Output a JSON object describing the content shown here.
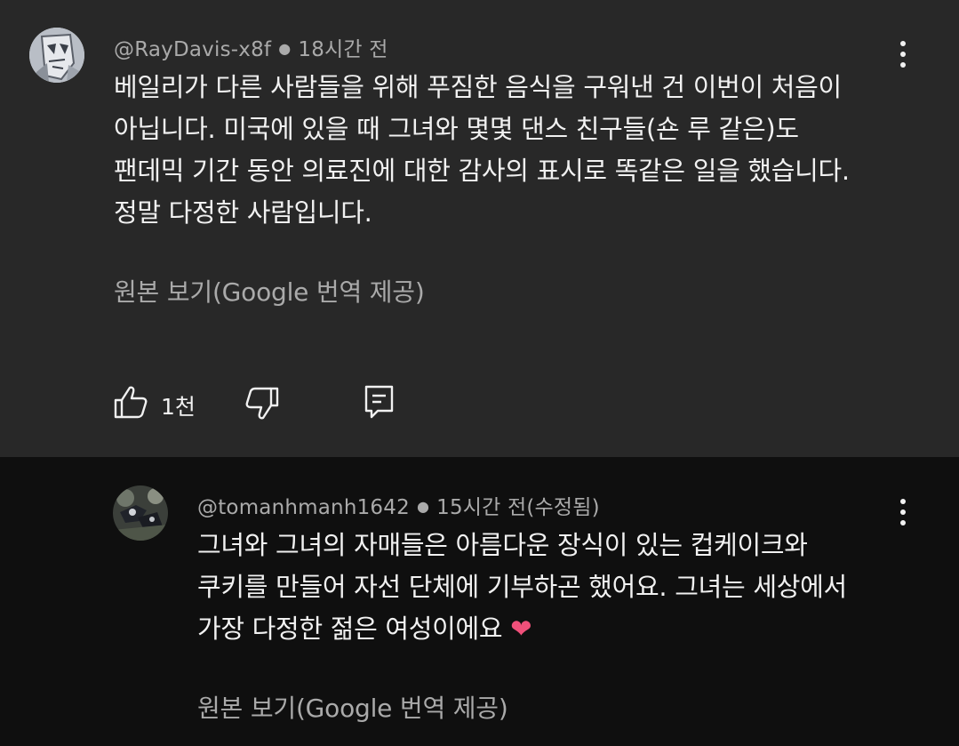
{
  "comments": [
    {
      "author": "@RayDavis-x8f",
      "time": "18시간 전",
      "lines": [
        "베일리가 다른 사람들을 위해 푸짐한 음식을 구워낸 건 이번이 처음이",
        "아닙니다. 미국에 있을 때 그녀와 몇몇 댄스 친구들(숀 루 같은)도",
        "팬데믹 기간 동안 의료진에 대한 감사의 표시로 똑같은 일을 했습니다.",
        "정말 다정한 사람입니다."
      ],
      "translate_label": "원본 보기(Google 번역 제공)",
      "likes": "1천",
      "avatar_icon": "user-avatar"
    },
    {
      "author": "@tomanhmanh1642",
      "time": "15시간 전(수정됨)",
      "lines": [
        "그녀와 그녀의 자매들은 아름다운 장식이 있는 컵케이크와",
        "쿠키를 만들어 자선 단체에 기부하곤 했어요. 그녀는 세상에서",
        "가장 다정한 젊은 여성이에요"
      ],
      "emoji": "❤",
      "translate_label": "원본 보기(Google 번역 제공)",
      "avatar_icon": "user-avatar"
    }
  ],
  "colors": {
    "top_bg": "#282828",
    "reply_bg": "#0f0f0f",
    "meta": "#aaaaaa",
    "text": "#f1f1f1",
    "heart": "#f0507a"
  },
  "icons": {
    "like": "thumbs-up-icon",
    "dislike": "thumbs-down-icon",
    "reply": "comment-icon",
    "more": "more-vertical-icon"
  }
}
